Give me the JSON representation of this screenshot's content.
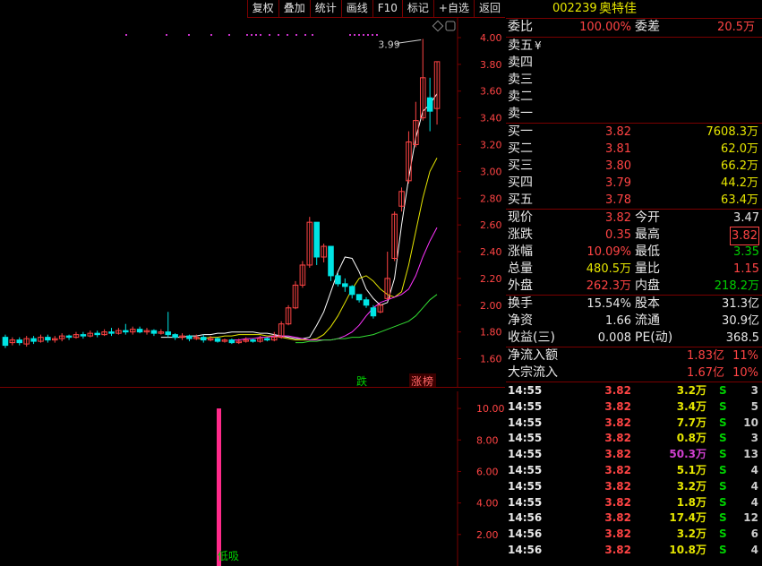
{
  "toolbar": [
    "复权",
    "叠加",
    "统计",
    "画线",
    "F10",
    "标记",
    "+自选",
    "返回"
  ],
  "stock": {
    "code": "002239",
    "name": "奥特佳"
  },
  "order_ratio": {
    "label1": "委比",
    "value1": "100.00%",
    "label2": "委差",
    "value2": "20.5万"
  },
  "asks": [
    {
      "label": "卖五",
      "price": "¥",
      "vol": ""
    },
    {
      "label": "卖四",
      "price": "",
      "vol": ""
    },
    {
      "label": "卖三",
      "price": "",
      "vol": ""
    },
    {
      "label": "卖二",
      "price": "",
      "vol": ""
    },
    {
      "label": "卖一",
      "price": "",
      "vol": ""
    }
  ],
  "bids": [
    {
      "label": "买一",
      "price": "3.82",
      "vol": "7608.3万"
    },
    {
      "label": "买二",
      "price": "3.81",
      "vol": "62.0万"
    },
    {
      "label": "买三",
      "price": "3.80",
      "vol": "66.2万"
    },
    {
      "label": "买四",
      "price": "3.79",
      "vol": "44.2万"
    },
    {
      "label": "买五",
      "price": "3.78",
      "vol": "63.4万"
    }
  ],
  "quote": [
    {
      "l1": "现价",
      "v1": "3.82",
      "l2": "今开",
      "v2": "3.47"
    },
    {
      "l1": "涨跌",
      "v1": "0.35",
      "l2": "最高",
      "v2": "3.82"
    },
    {
      "l1": "涨幅",
      "v1": "10.09%",
      "l2": "最低",
      "v2": "3.35"
    },
    {
      "l1": "总量",
      "v1": "480.5万",
      "l2": "量比",
      "v2": "1.15"
    },
    {
      "l1": "外盘",
      "v1": "262.3万",
      "l2": "内盘",
      "v2": "218.2万"
    }
  ],
  "stats": [
    {
      "l1": "换手",
      "v1": "15.54%",
      "l2": "股本",
      "v2": "31.3亿"
    },
    {
      "l1": "净资",
      "v1": "1.66",
      "l2": "流通",
      "v2": "30.9亿"
    },
    {
      "l1": "收益(三)",
      "v1": "0.008",
      "l2": "PE(动)",
      "v2": "368.5"
    }
  ],
  "flows": [
    {
      "label": "净流入额",
      "value": "1.83亿",
      "pct": "11%"
    },
    {
      "label": "大宗流入",
      "value": "1.67亿",
      "pct": "10%"
    }
  ],
  "ticks": [
    {
      "time": "14:55",
      "price": "3.82",
      "vol": "3.2万",
      "side": "S",
      "n": "3"
    },
    {
      "time": "14:55",
      "price": "3.82",
      "vol": "3.4万",
      "side": "S",
      "n": "5"
    },
    {
      "time": "14:55",
      "price": "3.82",
      "vol": "7.7万",
      "side": "S",
      "n": "10"
    },
    {
      "time": "14:55",
      "price": "3.82",
      "vol": "0.8万",
      "side": "S",
      "n": "3"
    },
    {
      "time": "14:55",
      "price": "3.82",
      "vol": "50.3万",
      "side": "S",
      "n": "13"
    },
    {
      "time": "14:55",
      "price": "3.82",
      "vol": "5.1万",
      "side": "S",
      "n": "4"
    },
    {
      "time": "14:55",
      "price": "3.82",
      "vol": "3.2万",
      "side": "S",
      "n": "4"
    },
    {
      "time": "14:55",
      "price": "3.82",
      "vol": "1.8万",
      "side": "S",
      "n": "4"
    },
    {
      "time": "14:56",
      "price": "3.82",
      "vol": "17.4万",
      "side": "S",
      "n": "12"
    },
    {
      "time": "14:56",
      "price": "3.82",
      "vol": "3.2万",
      "side": "S",
      "n": "6"
    },
    {
      "time": "14:56",
      "price": "3.82",
      "vol": "10.8万",
      "side": "S",
      "n": "4"
    }
  ],
  "chart_data": [
    {
      "type": "candlestick",
      "y_ticks": [
        "4.00",
        "3.80",
        "3.60",
        "3.40",
        "3.20",
        "3.00",
        "2.80",
        "2.60",
        "2.40",
        "2.20",
        "2.00",
        "1.80",
        "1.60"
      ],
      "ylim": [
        1.55,
        4.02
      ],
      "peak_label": "3.99",
      "markers": [
        {
          "text": "跌"
        },
        {
          "text": "涨",
          "badge": "榜"
        }
      ],
      "candles": [
        [
          1.76,
          1.7,
          1.78,
          1.68
        ],
        [
          1.72,
          1.74,
          1.76,
          1.7
        ],
        [
          1.74,
          1.72,
          1.76,
          1.7
        ],
        [
          1.71,
          1.75,
          1.77,
          1.69
        ],
        [
          1.75,
          1.73,
          1.77,
          1.71
        ],
        [
          1.73,
          1.76,
          1.78,
          1.72
        ],
        [
          1.76,
          1.74,
          1.78,
          1.72
        ],
        [
          1.74,
          1.75,
          1.77,
          1.72
        ],
        [
          1.75,
          1.77,
          1.79,
          1.73
        ],
        [
          1.77,
          1.76,
          1.78,
          1.74
        ],
        [
          1.76,
          1.78,
          1.8,
          1.75
        ],
        [
          1.78,
          1.77,
          1.8,
          1.75
        ],
        [
          1.77,
          1.79,
          1.81,
          1.76
        ],
        [
          1.79,
          1.78,
          1.81,
          1.76
        ],
        [
          1.78,
          1.8,
          1.82,
          1.77
        ],
        [
          1.8,
          1.79,
          1.83,
          1.77
        ],
        [
          1.79,
          1.81,
          1.83,
          1.78
        ],
        [
          1.81,
          1.8,
          1.86,
          1.78
        ],
        [
          1.8,
          1.82,
          1.84,
          1.78
        ],
        [
          1.82,
          1.8,
          1.84,
          1.79
        ],
        [
          1.8,
          1.81,
          1.83,
          1.78
        ],
        [
          1.81,
          1.79,
          1.82,
          1.77
        ],
        [
          1.79,
          1.8,
          1.82,
          1.78
        ],
        [
          1.8,
          1.78,
          1.95,
          1.76
        ],
        [
          1.78,
          1.76,
          1.79,
          1.74
        ],
        [
          1.76,
          1.77,
          1.79,
          1.74
        ],
        [
          1.77,
          1.75,
          1.78,
          1.73
        ],
        [
          1.75,
          1.76,
          1.78,
          1.74
        ],
        [
          1.76,
          1.74,
          1.78,
          1.72
        ],
        [
          1.74,
          1.75,
          1.77,
          1.73
        ],
        [
          1.75,
          1.73,
          1.76,
          1.72
        ],
        [
          1.73,
          1.74,
          1.75,
          1.72
        ],
        [
          1.74,
          1.72,
          1.75,
          1.71
        ],
        [
          1.72,
          1.73,
          1.75,
          1.71
        ],
        [
          1.73,
          1.74,
          1.76,
          1.72
        ],
        [
          1.74,
          1.73,
          1.75,
          1.72
        ],
        [
          1.73,
          1.75,
          1.77,
          1.72
        ],
        [
          1.75,
          1.74,
          1.76,
          1.73
        ],
        [
          1.74,
          1.76,
          1.8,
          1.73
        ],
        [
          1.76,
          1.86,
          1.88,
          1.75
        ],
        [
          1.86,
          1.98,
          2.0,
          1.85
        ],
        [
          1.98,
          2.15,
          2.18,
          1.97
        ],
        [
          2.15,
          2.3,
          2.33,
          2.13
        ],
        [
          2.3,
          2.62,
          2.66,
          2.28
        ],
        [
          2.62,
          2.36,
          2.44,
          2.3
        ],
        [
          2.36,
          2.44,
          2.46,
          2.32
        ],
        [
          2.44,
          2.22,
          2.42,
          2.18
        ],
        [
          2.22,
          2.16,
          2.24,
          2.14
        ],
        [
          2.16,
          2.14,
          2.2,
          2.1
        ],
        [
          2.14,
          2.08,
          2.15,
          2.05
        ],
        [
          2.08,
          2.04,
          2.08,
          2.02
        ],
        [
          2.04,
          2.0,
          2.06,
          1.98
        ],
        [
          1.98,
          1.92,
          2.0,
          1.9
        ],
        [
          1.95,
          2.0,
          2.01,
          1.94
        ],
        [
          2.05,
          2.2,
          2.4,
          2.04
        ],
        [
          2.35,
          2.68,
          2.7,
          2.33
        ],
        [
          2.74,
          2.85,
          2.88,
          2.7
        ],
        [
          2.93,
          3.22,
          3.3,
          2.91
        ],
        [
          3.2,
          3.38,
          3.52,
          3.18
        ],
        [
          3.4,
          3.7,
          3.99,
          3.38
        ],
        [
          3.55,
          3.45,
          3.7,
          3.3
        ],
        [
          3.47,
          3.82,
          3.82,
          3.35
        ]
      ],
      "ma_lines": [
        {
          "color": "#ffffff",
          "values": [
            1.76,
            1.76,
            1.76,
            1.76,
            1.77,
            1.77,
            1.78,
            1.78,
            1.79,
            1.79,
            1.8,
            1.8,
            1.8,
            1.8,
            1.79,
            1.79,
            1.78,
            1.77,
            1.76,
            1.75,
            1.75,
            1.76,
            1.85,
            1.95,
            2.1,
            2.25,
            2.36,
            2.35,
            2.25,
            2.12,
            2.05,
            2.0,
            2.02,
            2.2,
            2.6,
            2.95,
            3.25,
            3.45,
            3.5,
            3.58
          ]
        },
        {
          "color": "#e6e600",
          "values": [
            1.75,
            1.75,
            1.76,
            1.76,
            1.77,
            1.77,
            1.78,
            1.78,
            1.78,
            1.78,
            1.77,
            1.77,
            1.76,
            1.75,
            1.74,
            1.74,
            1.74,
            1.75,
            1.78,
            1.84,
            1.92,
            2.02,
            2.12,
            2.2,
            2.22,
            2.18,
            2.12,
            2.08,
            2.06,
            2.1,
            2.3,
            2.55,
            2.8,
            3.0,
            3.1
          ]
        },
        {
          "color": "#ff33ff",
          "values": [
            1.74,
            1.74,
            1.75,
            1.75,
            1.76,
            1.76,
            1.77,
            1.77,
            1.77,
            1.76,
            1.75,
            1.74,
            1.74,
            1.74,
            1.74,
            1.75,
            1.77,
            1.8,
            1.85,
            1.92,
            1.98,
            2.02,
            2.04,
            2.06,
            2.08,
            2.12,
            2.22,
            2.36,
            2.48,
            2.58
          ]
        },
        {
          "color": "#33dd33",
          "values": [
            1.72,
            1.72,
            1.73,
            1.73,
            1.74,
            1.74,
            1.75,
            1.75,
            1.76,
            1.76,
            1.77,
            1.78,
            1.8,
            1.82,
            1.84,
            1.86,
            1.88,
            1.92,
            1.98,
            2.04,
            2.08
          ]
        }
      ]
    },
    {
      "type": "bar",
      "y_ticks": [
        "10.00",
        "8.00",
        "6.00",
        "4.00",
        "2.00"
      ],
      "ylim": [
        0,
        10.8
      ],
      "bars": [
        {
          "value": 10.0,
          "label": "低吸"
        }
      ]
    }
  ]
}
